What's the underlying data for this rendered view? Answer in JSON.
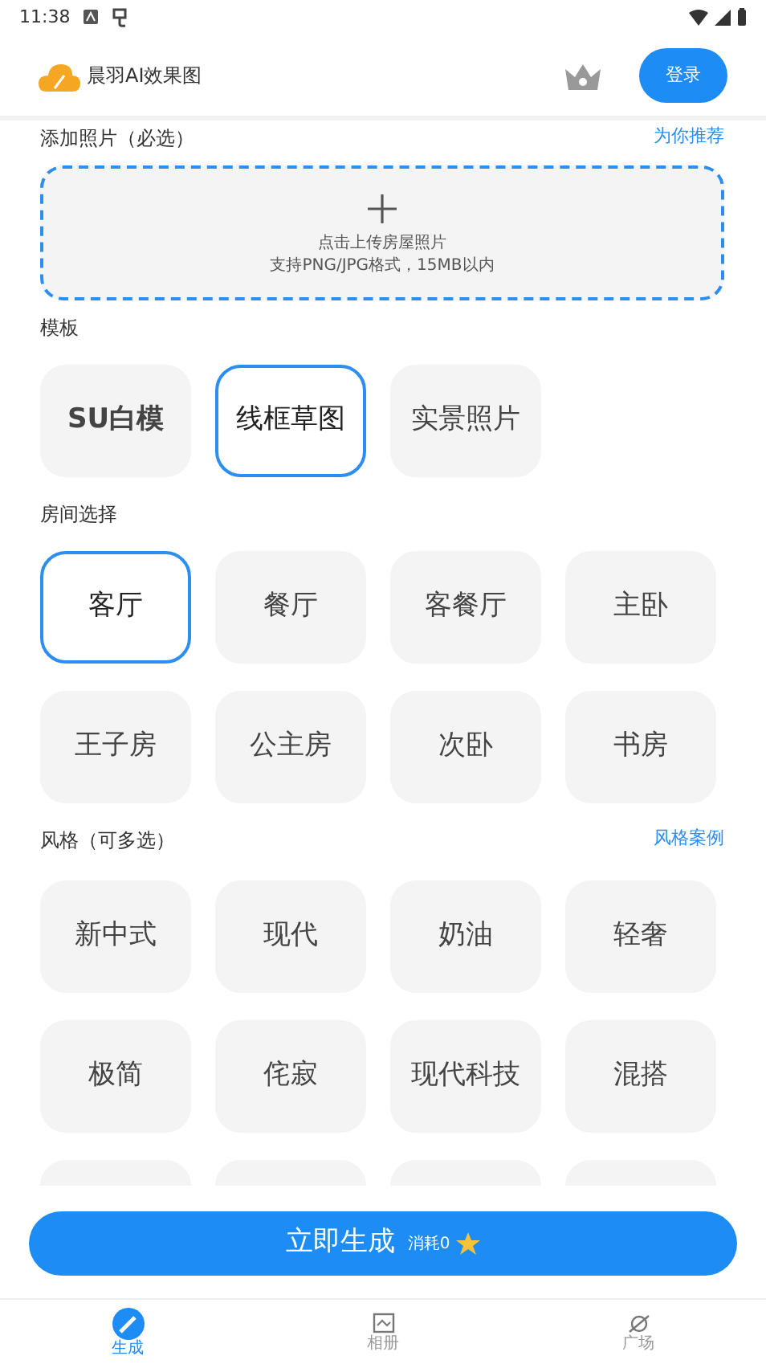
{
  "status_bar": {
    "time": "11:38"
  },
  "header": {
    "app_name": "晨羽AI效果图",
    "login_button": "登录"
  },
  "photo_section": {
    "title": "添加照片（必选）",
    "link": "为你推荐",
    "upload_hint": "点击上传房屋照片",
    "upload_formats": "支持PNG/JPG格式，15MB以内"
  },
  "template_section": {
    "title": "模板",
    "options": [
      {
        "label": "SU白模",
        "selected": false,
        "bold": true
      },
      {
        "label": "线框草图",
        "selected": true,
        "bold": false
      },
      {
        "label": "实景照片",
        "selected": false,
        "bold": false
      }
    ]
  },
  "room_section": {
    "title": "房间选择",
    "options": [
      {
        "label": "客厅",
        "selected": true
      },
      {
        "label": "餐厅",
        "selected": false
      },
      {
        "label": "客餐厅",
        "selected": false
      },
      {
        "label": "主卧",
        "selected": false
      },
      {
        "label": "王子房",
        "selected": false
      },
      {
        "label": "公主房",
        "selected": false
      },
      {
        "label": "次卧",
        "selected": false
      },
      {
        "label": "书房",
        "selected": false
      }
    ]
  },
  "style_section": {
    "title": "风格（可多选）",
    "link": "风格案例",
    "options": [
      {
        "label": "新中式",
        "selected": false
      },
      {
        "label": "现代",
        "selected": false
      },
      {
        "label": "奶油",
        "selected": false
      },
      {
        "label": "轻奢",
        "selected": false
      },
      {
        "label": "极简",
        "selected": false
      },
      {
        "label": "侘寂",
        "selected": false
      },
      {
        "label": "现代科技",
        "selected": false
      },
      {
        "label": "混搭",
        "selected": false
      },
      {
        "selected": false
      },
      {
        "selected": false
      },
      {
        "selected": false
      },
      {
        "selected": false
      }
    ]
  },
  "generate_button": {
    "label": "立即生成",
    "cost": "消耗0"
  },
  "bottom_nav": [
    {
      "label": "生成",
      "selected": true
    },
    {
      "label": "相册",
      "selected": false
    },
    {
      "label": "广场",
      "selected": false
    }
  ]
}
